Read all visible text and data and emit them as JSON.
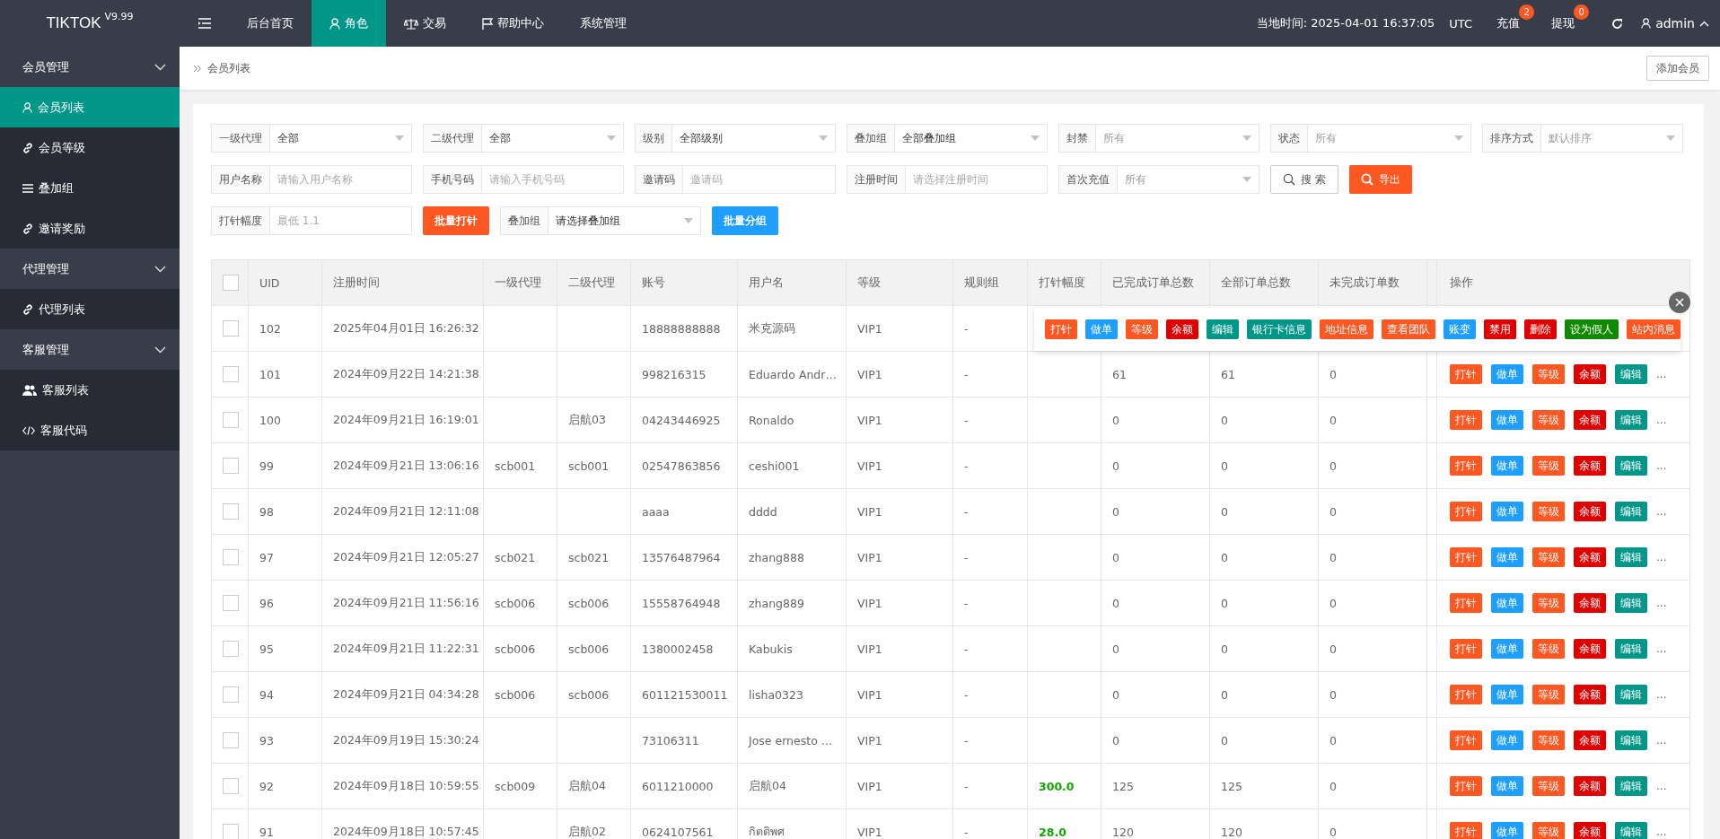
{
  "topbar": {
    "logo": "TIKTOK",
    "version": "V9.99",
    "nav": [
      {
        "label": "后台首页",
        "selected": false
      },
      {
        "label": "角色",
        "selected": true
      },
      {
        "label": "交易",
        "selected": false
      },
      {
        "label": "帮助中心",
        "selected": false
      },
      {
        "label": "系统管理",
        "selected": false
      }
    ],
    "clock": "当地时间: 2025-04-01 16:37:05",
    "timezone": "UTC",
    "links": [
      {
        "label": "充值",
        "badge": "2"
      },
      {
        "label": "提现",
        "badge": "0"
      }
    ],
    "user": "admin"
  },
  "sidebar": [
    {
      "label": "会员管理",
      "expanded": true,
      "children": [
        {
          "label": "会员列表",
          "selected": true
        },
        {
          "label": "会员等级",
          "selected": false
        },
        {
          "label": "叠加组",
          "selected": false
        },
        {
          "label": "邀请奖励",
          "selected": false
        }
      ]
    },
    {
      "label": "代理管理",
      "expanded": true,
      "children": [
        {
          "label": "代理列表",
          "selected": false
        }
      ]
    },
    {
      "label": "客服管理",
      "expanded": true,
      "children": [
        {
          "label": "客服列表",
          "selected": false
        },
        {
          "label": "客服代码",
          "selected": false
        }
      ]
    }
  ],
  "breadcrumb": "会员列表",
  "add_button": "添加会员",
  "filter_rows": [
    [
      {
        "kind": "select",
        "label": "一级代理",
        "value": "全部"
      },
      {
        "kind": "select",
        "label": "二级代理",
        "value": "全部"
      },
      {
        "kind": "select",
        "label": "级别",
        "value": "全部级别"
      },
      {
        "kind": "select",
        "label": "叠加组",
        "value": "全部叠加组"
      },
      {
        "kind": "select",
        "label": "封禁",
        "placeholder": "所有"
      },
      {
        "kind": "select",
        "label": "状态",
        "placeholder": "所有"
      },
      {
        "kind": "select",
        "label": "排序方式",
        "placeholder": "默认排序"
      }
    ],
    [
      {
        "kind": "input",
        "label": "用户名称",
        "placeholder": "请输入用户名称"
      },
      {
        "kind": "input",
        "label": "手机号码",
        "placeholder": "请输入手机号码"
      },
      {
        "kind": "input",
        "label": "邀请码",
        "placeholder": "邀请码"
      },
      {
        "kind": "input",
        "label": "注册时间",
        "placeholder": "请选择注册时间"
      },
      {
        "kind": "select",
        "label": "首次充值",
        "placeholder": "所有"
      },
      {
        "kind": "search",
        "label": "搜 索"
      },
      {
        "kind": "export",
        "label": "导出"
      }
    ],
    [
      {
        "kind": "input",
        "label": "打针幅度",
        "placeholder": "最低 1.1"
      },
      {
        "kind": "orange",
        "label": "批量打针"
      },
      {
        "kind": "select",
        "label": "叠加组",
        "value": "请选择叠加组"
      },
      {
        "kind": "blue",
        "label": "批量分组"
      }
    ]
  ],
  "table": {
    "select_all_checked": false,
    "columns": [
      "UID",
      "注册时间",
      "一级代理",
      "二级代理",
      "账号",
      "用户名",
      "等级",
      "规则组",
      "打针幅度",
      "已完成订单总数",
      "全部订单总数",
      "未完成订单数",
      "操作"
    ],
    "rows": [
      {
        "checked": false,
        "uid": "102",
        "registered": "2025年04月01日 16:26:32",
        "account": "18888888888",
        "username": "米克源码",
        "level": "VIP1",
        "rule_group": "-"
      },
      {
        "checked": false,
        "uid": "101",
        "registered": "2024年09月22日 14:21:38",
        "account": "998216315",
        "username": "Eduardo Andr…",
        "level": "VIP1",
        "rule_group": "-",
        "completed": "61",
        "total": "61",
        "pending": "0",
        "more": "...",
        "actions": [
          {
            "label": "打针",
            "color": "#ff5722"
          },
          {
            "label": "做单",
            "color": "#1e9fff"
          },
          {
            "label": "等级",
            "color": "#ff5722"
          },
          {
            "label": "余额",
            "color": "#e00000"
          },
          {
            "label": "编辑",
            "color": "#009688"
          }
        ]
      },
      {
        "checked": false,
        "uid": "100",
        "registered": "2024年09月21日 16:19:01",
        "agent2": "启航03",
        "account": "04243446925",
        "username": "Ronaldo",
        "level": "VIP1",
        "rule_group": "-",
        "completed": "0",
        "total": "0",
        "pending": "0",
        "more": "...",
        "actions": [
          {
            "label": "打针",
            "color": "#ff5722"
          },
          {
            "label": "做单",
            "color": "#1e9fff"
          },
          {
            "label": "等级",
            "color": "#ff5722"
          },
          {
            "label": "余额",
            "color": "#e00000"
          },
          {
            "label": "编辑",
            "color": "#009688"
          }
        ]
      },
      {
        "checked": false,
        "uid": "99",
        "registered": "2024年09月21日 13:06:16",
        "agent1": "scb001",
        "agent2": "scb001",
        "account": "02547863856",
        "username": "ceshi001",
        "level": "VIP1",
        "rule_group": "-",
        "completed": "0",
        "total": "0",
        "pending": "0",
        "more": "...",
        "actions": [
          {
            "label": "打针",
            "color": "#ff5722"
          },
          {
            "label": "做单",
            "color": "#1e9fff"
          },
          {
            "label": "等级",
            "color": "#ff5722"
          },
          {
            "label": "余额",
            "color": "#e00000"
          },
          {
            "label": "编辑",
            "color": "#009688"
          }
        ]
      },
      {
        "checked": false,
        "uid": "98",
        "registered": "2024年09月21日 12:11:08",
        "account": "aaaa",
        "username": "dddd",
        "level": "VIP1",
        "rule_group": "-",
        "completed": "0",
        "total": "0",
        "pending": "0",
        "more": "...",
        "actions": [
          {
            "label": "打针",
            "color": "#ff5722"
          },
          {
            "label": "做单",
            "color": "#1e9fff"
          },
          {
            "label": "等级",
            "color": "#ff5722"
          },
          {
            "label": "余额",
            "color": "#e00000"
          },
          {
            "label": "编辑",
            "color": "#009688"
          }
        ]
      },
      {
        "checked": false,
        "uid": "97",
        "registered": "2024年09月21日 12:05:27",
        "agent1": "scb021",
        "agent2": "scb021",
        "account": "13576487964",
        "username": "zhang888",
        "level": "VIP1",
        "rule_group": "-",
        "completed": "0",
        "total": "0",
        "pending": "0",
        "more": "...",
        "actions": [
          {
            "label": "打针",
            "color": "#ff5722"
          },
          {
            "label": "做单",
            "color": "#1e9fff"
          },
          {
            "label": "等级",
            "color": "#ff5722"
          },
          {
            "label": "余额",
            "color": "#e00000"
          },
          {
            "label": "编辑",
            "color": "#009688"
          }
        ]
      },
      {
        "checked": false,
        "uid": "96",
        "registered": "2024年09月21日 11:56:16",
        "agent1": "scb006",
        "agent2": "scb006",
        "account": "15558764948",
        "username": "zhang889",
        "level": "VIP1",
        "rule_group": "-",
        "completed": "0",
        "total": "0",
        "pending": "0",
        "more": "...",
        "actions": [
          {
            "label": "打针",
            "color": "#ff5722"
          },
          {
            "label": "做单",
            "color": "#1e9fff"
          },
          {
            "label": "等级",
            "color": "#ff5722"
          },
          {
            "label": "余额",
            "color": "#e00000"
          },
          {
            "label": "编辑",
            "color": "#009688"
          }
        ]
      },
      {
        "checked": false,
        "uid": "95",
        "registered": "2024年09月21日 11:22:31",
        "agent1": "scb006",
        "agent2": "scb006",
        "account": "1380002458",
        "username": "Kabukis",
        "level": "VIP1",
        "rule_group": "-",
        "completed": "0",
        "total": "0",
        "pending": "0",
        "more": "...",
        "actions": [
          {
            "label": "打针",
            "color": "#ff5722"
          },
          {
            "label": "做单",
            "color": "#1e9fff"
          },
          {
            "label": "等级",
            "color": "#ff5722"
          },
          {
            "label": "余额",
            "color": "#e00000"
          },
          {
            "label": "编辑",
            "color": "#009688"
          }
        ]
      },
      {
        "checked": false,
        "uid": "94",
        "registered": "2024年09月21日 04:34:28",
        "agent1": "scb006",
        "agent2": "scb006",
        "account": "601121530011",
        "username": "lisha0323",
        "level": "VIP1",
        "rule_group": "-",
        "completed": "0",
        "total": "0",
        "pending": "0",
        "more": "...",
        "actions": [
          {
            "label": "打针",
            "color": "#ff5722"
          },
          {
            "label": "做单",
            "color": "#1e9fff"
          },
          {
            "label": "等级",
            "color": "#ff5722"
          },
          {
            "label": "余额",
            "color": "#e00000"
          },
          {
            "label": "编辑",
            "color": "#009688"
          }
        ]
      },
      {
        "checked": false,
        "uid": "93",
        "registered": "2024年09月19日 15:30:24",
        "account": "73106311",
        "username": "Jose ernesto …",
        "level": "VIP1",
        "rule_group": "-",
        "completed": "0",
        "total": "0",
        "pending": "0",
        "more": "...",
        "actions": [
          {
            "label": "打针",
            "color": "#ff5722"
          },
          {
            "label": "做单",
            "color": "#1e9fff"
          },
          {
            "label": "等级",
            "color": "#ff5722"
          },
          {
            "label": "余额",
            "color": "#e00000"
          },
          {
            "label": "编辑",
            "color": "#009688"
          }
        ]
      },
      {
        "checked": false,
        "uid": "92",
        "registered": "2024年09月18日 10:59:55",
        "agent1": "scb009",
        "agent2": "启航04",
        "account": "6011210000",
        "username": "启航04",
        "level": "VIP1",
        "rule_group": "-",
        "needle": "300.0",
        "completed": "125",
        "total": "125",
        "pending": "0",
        "more": "...",
        "actions": [
          {
            "label": "打针",
            "color": "#ff5722"
          },
          {
            "label": "做单",
            "color": "#1e9fff"
          },
          {
            "label": "等级",
            "color": "#ff5722"
          },
          {
            "label": "余额",
            "color": "#e00000"
          },
          {
            "label": "编辑",
            "color": "#009688"
          }
        ]
      },
      {
        "checked": false,
        "uid": "91",
        "registered": "2024年09月18日 10:57:45",
        "agent2": "启航02",
        "account": "0624107561",
        "username": "กิตติพศ",
        "level": "VIP1",
        "rule_group": "-",
        "needle": "28.0",
        "completed": "120",
        "total": "120",
        "pending": "0",
        "more": "...",
        "actions": [
          {
            "label": "打针",
            "color": "#ff5722"
          },
          {
            "label": "做单",
            "color": "#1e9fff"
          },
          {
            "label": "等级",
            "color": "#ff5722"
          },
          {
            "label": "余额",
            "color": "#e00000"
          },
          {
            "label": "编辑",
            "color": "#009688"
          }
        ]
      }
    ]
  },
  "action_popover": {
    "buttons": [
      {
        "label": "打针",
        "color": "#ff5722"
      },
      {
        "label": "做单",
        "color": "#1e9fff"
      },
      {
        "label": "等级",
        "color": "#ff5722"
      },
      {
        "label": "余额",
        "color": "#e00000"
      },
      {
        "label": "编辑",
        "color": "#009688"
      },
      {
        "label": "银行卡信息",
        "color": "#009688"
      },
      {
        "label": "地址信息",
        "color": "#ff5722"
      },
      {
        "label": "查看团队",
        "color": "#ff5722"
      },
      {
        "label": "账变",
        "color": "#1e9fff"
      },
      {
        "label": "禁用",
        "color": "#e00000"
      },
      {
        "label": "删除",
        "color": "#e00000"
      },
      {
        "label": "设为假人",
        "color": "#108a00"
      },
      {
        "label": "站内消息",
        "color": "#ff5722"
      }
    ]
  }
}
